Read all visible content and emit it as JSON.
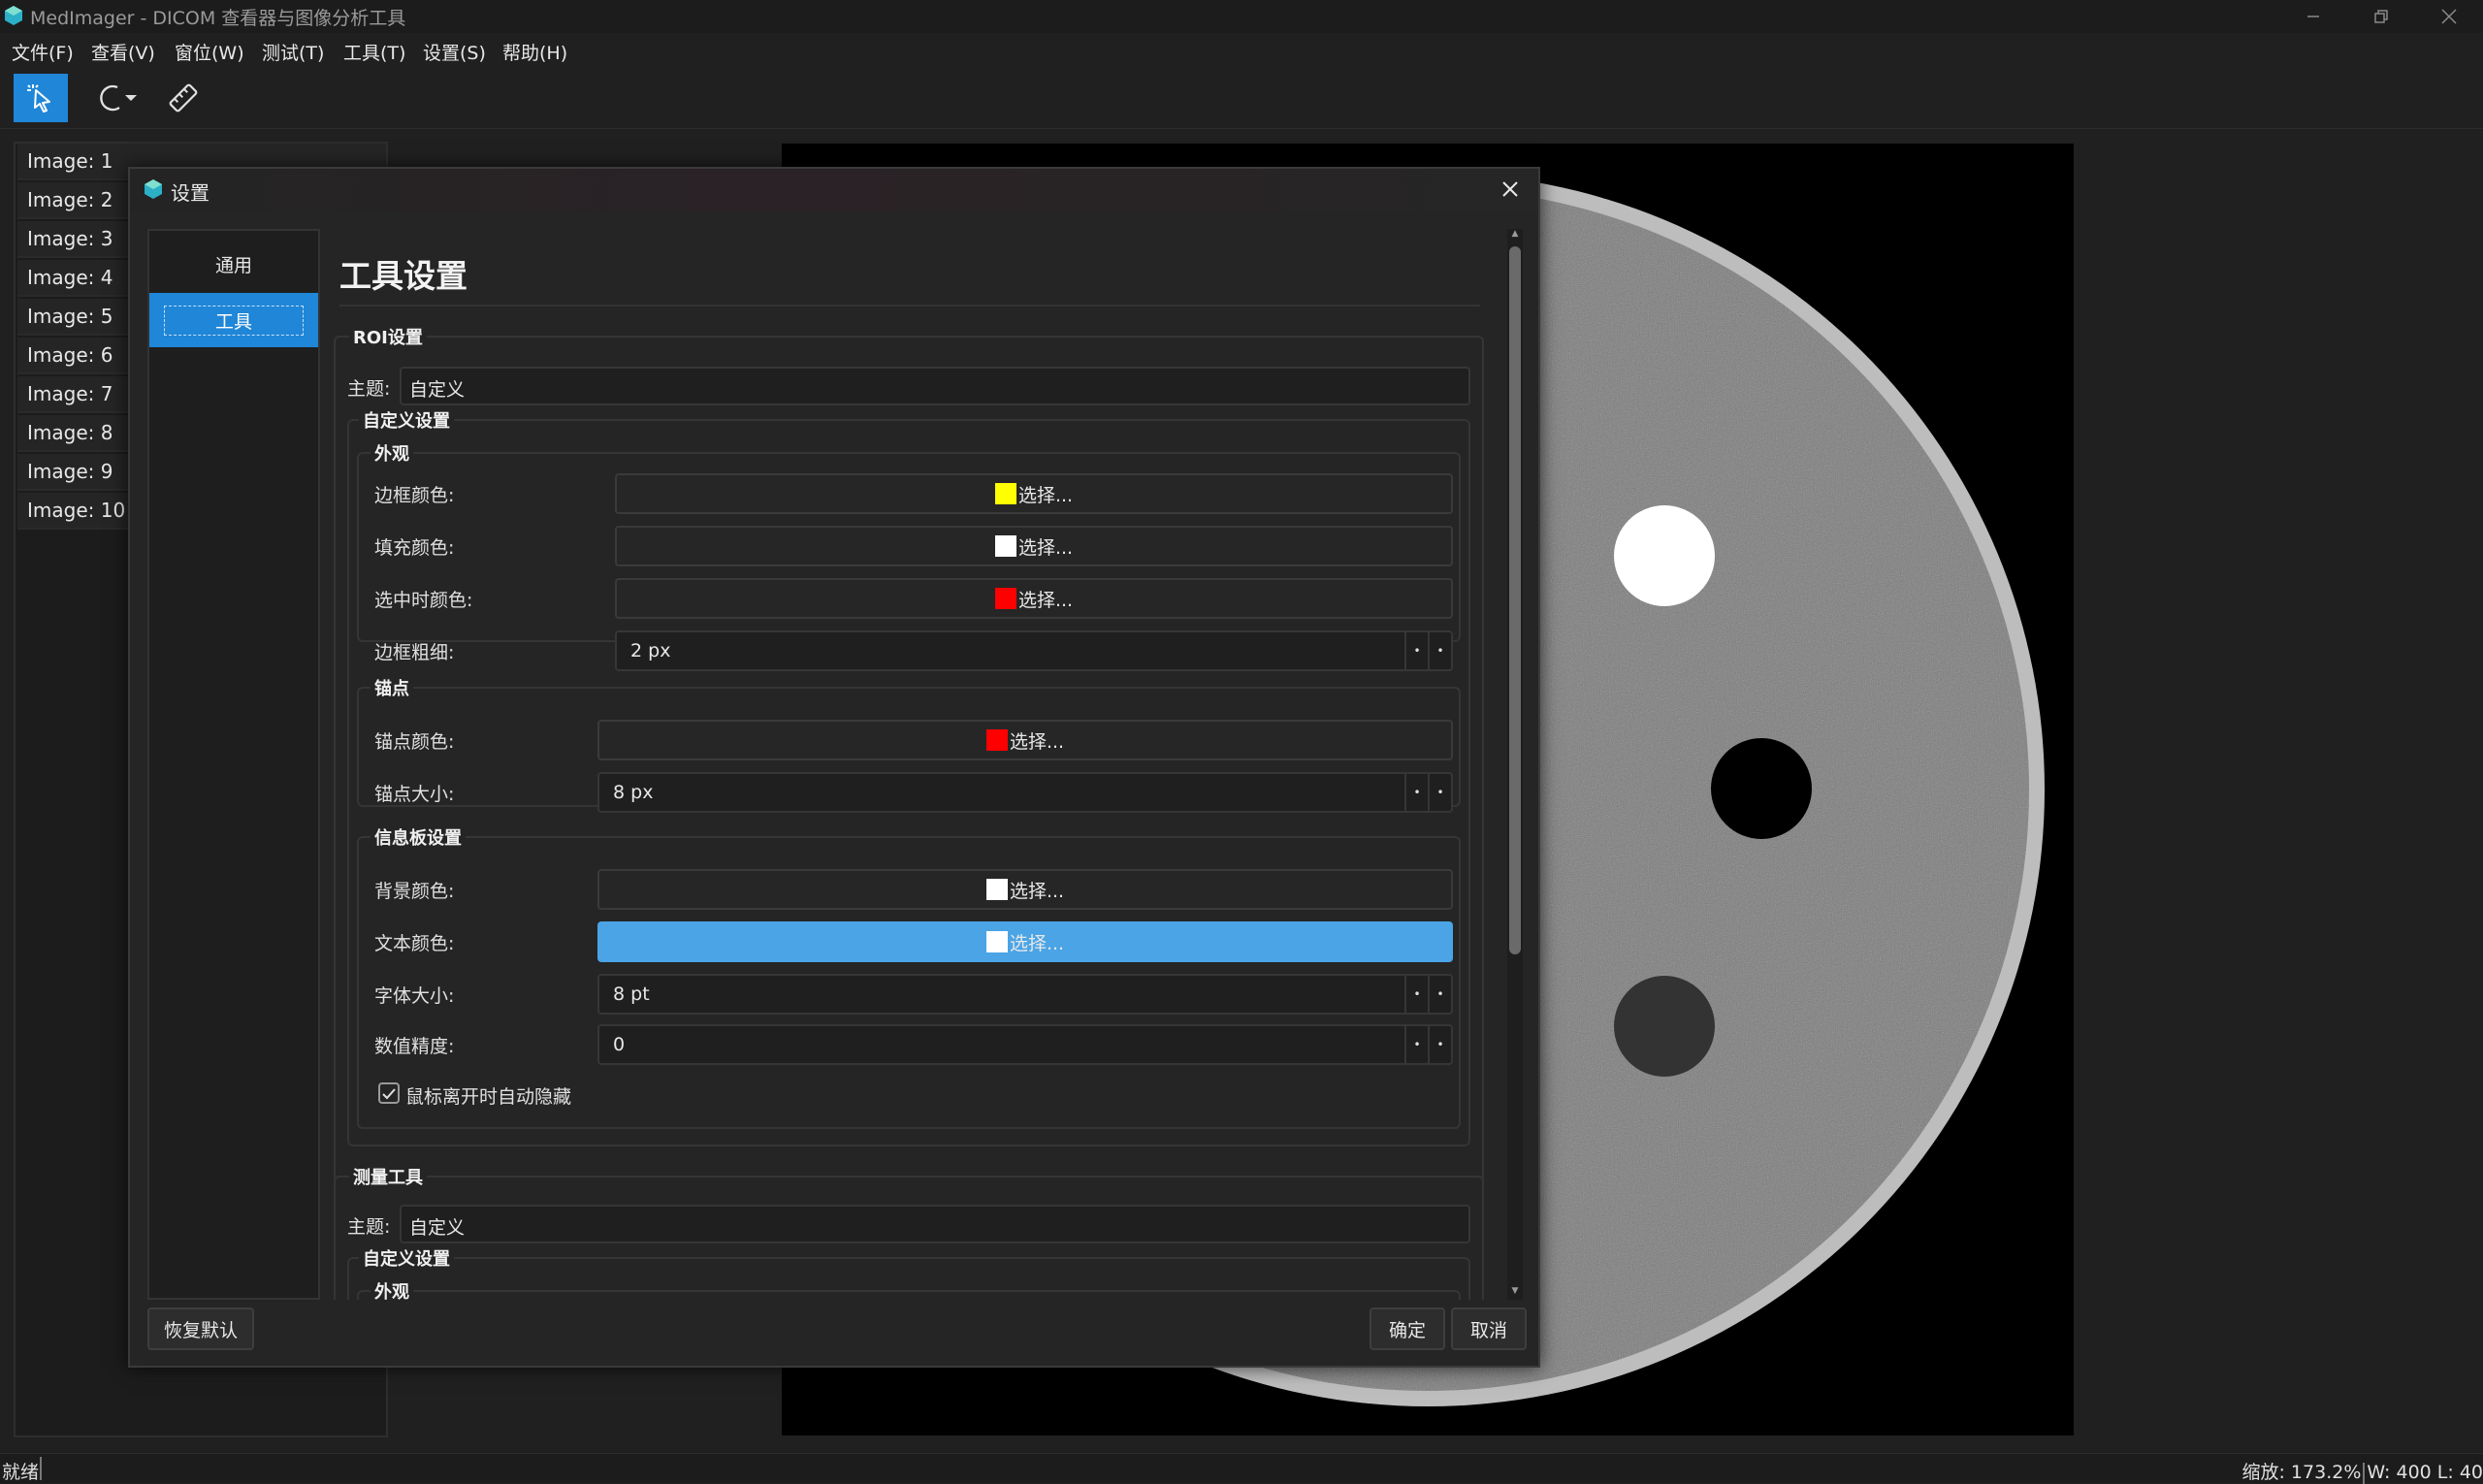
{
  "window": {
    "title": "MedImager - DICOM 查看器与图像分析工具"
  },
  "menu": [
    "文件(F)",
    "查看(V)",
    "窗位(W)",
    "测试(T)",
    "工具(T)",
    "设置(S)",
    "帮助(H)"
  ],
  "images": [
    "Image: 1",
    "Image: 2",
    "Image: 3",
    "Image: 4",
    "Image: 5",
    "Image: 6",
    "Image: 7",
    "Image: 8",
    "Image: 9",
    "Image: 10"
  ],
  "status": {
    "left": "就绪",
    "zoom": "缩放: 173.2%",
    "window_level": "W: 400 L: 40"
  },
  "dialog": {
    "title": "设置",
    "nav": {
      "general": "通用",
      "tools": "工具"
    },
    "page_title": "工具设置",
    "choose_label": "选择...",
    "roi": {
      "title": "ROI设置",
      "theme_label": "主题:",
      "theme_value": "自定义",
      "custom_title": "自定义设置",
      "appearance": {
        "title": "外观",
        "border_color_label": "边框颜色:",
        "border_color": "#ffff00",
        "fill_color_label": "填充颜色:",
        "fill_color": "#ffffff",
        "selected_color_label": "选中时颜色:",
        "selected_color": "#ff0000",
        "border_width_label": "边框粗细:",
        "border_width_value": "2 px"
      },
      "anchor": {
        "title": "锚点",
        "color_label": "锚点颜色:",
        "color": "#ff0000",
        "size_label": "锚点大小:",
        "size_value": "8 px"
      },
      "info_panel": {
        "title": "信息板设置",
        "bg_color_label": "背景颜色:",
        "bg_color": "#ffffff",
        "text_color_label": "文本颜色:",
        "text_color": "#ffffff",
        "font_size_label": "字体大小:",
        "font_size_value": "8 pt",
        "precision_label": "数值精度:",
        "precision_value": "0",
        "auto_hide_label": "鼠标离开时自动隐藏",
        "auto_hide_checked": true
      }
    },
    "measure": {
      "title": "测量工具",
      "theme_label": "主题:",
      "theme_value": "自定义",
      "custom_title": "自定义设置",
      "appearance_title": "外观",
      "line_color": "#00cc00"
    },
    "buttons": {
      "restore": "恢复默认",
      "ok": "确定",
      "cancel": "取消"
    }
  },
  "colors": {
    "accent": "#1f86d8",
    "hover": "#4aa4e6"
  }
}
